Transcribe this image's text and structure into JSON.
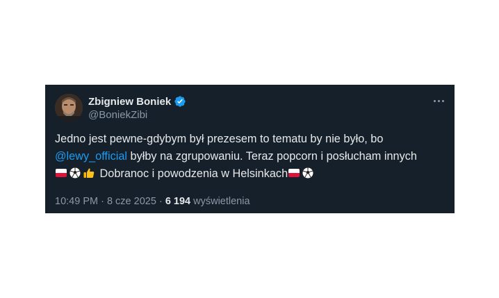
{
  "author": {
    "name": "Zbigniew Boniek",
    "handle": "@BoniekZibi"
  },
  "tweet": {
    "line1": "Jedno jest pewne-gdybym był prezesem to tematu by nie było, bo",
    "mention": "@lewy_official",
    "line2_rest": " byłby na zgrupowaniu. Teraz popcorn i posłucham innych",
    "line3_text": " Dobranoc i powodzenia w Helsinkach"
  },
  "meta": {
    "time": "10:49 PM",
    "separator1": " · ",
    "date": "8 cze 2025",
    "separator2": " · ",
    "views_count": "6 194",
    "views_label": " wyświetlenia"
  },
  "colors": {
    "background": "#15202b",
    "text": "#e7e9ea",
    "secondary": "#8b98a5",
    "accent": "#1d9bf0"
  },
  "icons": [
    "verified-badge-icon",
    "more-options-icon",
    "poland-flag-icon",
    "soccer-ball-icon",
    "thumbs-up-icon"
  ]
}
